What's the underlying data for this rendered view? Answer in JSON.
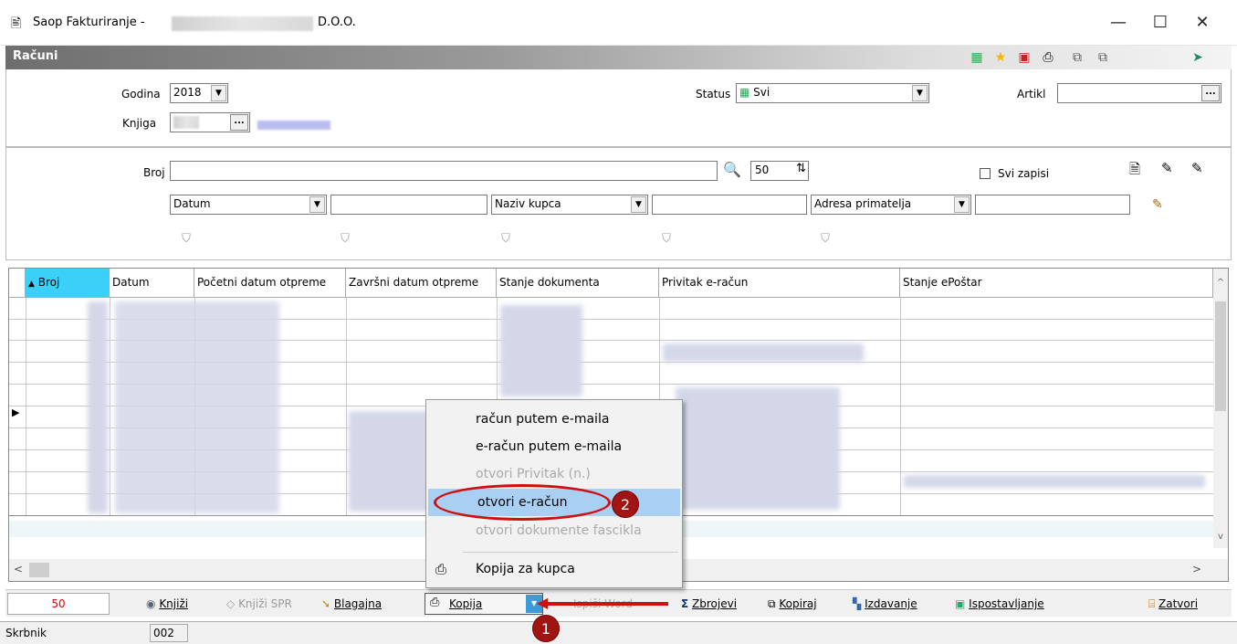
{
  "window": {
    "app_title_prefix": "Saop Fakturiranje -",
    "app_title_suffix": "D.O.O.",
    "minimize": "—",
    "maximize": "☐",
    "close": "✕"
  },
  "module": {
    "title": "Računi",
    "toolbar_icons": [
      "grid-icon",
      "star-icon",
      "pdf-icon",
      "print-icon",
      "copy-icon",
      "paste-icon",
      "export-icon"
    ]
  },
  "filters": {
    "godina_label": "Godina",
    "godina_value": "2018",
    "knjiga_label": "Knjiga",
    "status_label": "Status",
    "status_value": "Svi",
    "artikl_label": "Artikl",
    "broj_label": "Broj",
    "page_size": "50",
    "svi_zapisi_label": "Svi zapisi",
    "field1": "Datum",
    "field2": "Naziv kupca",
    "field3": "Adresa primatelja"
  },
  "grid": {
    "columns": [
      "Broj",
      "Datum",
      "Početni datum otpreme",
      "Završni datum otpreme",
      "Stanje dokumenta",
      "Privitak e-račun",
      "Stanje ePoštar"
    ],
    "sort_arrow": "▲"
  },
  "context_menu": {
    "items": [
      {
        "label": "račun putem e-maila",
        "enabled": true
      },
      {
        "label": "e-račun putem e-maila",
        "enabled": true
      },
      {
        "label": "otvori Privitak (n.)",
        "enabled": false
      },
      {
        "label": "otvori e-račun",
        "enabled": true,
        "highlighted": true
      },
      {
        "label": "otvori dokumente fascikla",
        "enabled": false
      },
      {
        "label": "Kopija za kupca",
        "enabled": true
      }
    ]
  },
  "bottom_bar": {
    "count": "50",
    "knjizi": "Knjiži",
    "knjizi_spr": "Knjiži SPR",
    "blagajna": "Blagajna",
    "kopija": "Kopija",
    "ispisi_word": "Ispiši Word",
    "zbrojevi": "Zbrojevi",
    "kopiraj": "Kopiraj",
    "izdavanje": "Izdavanje",
    "ispostavljanje": "Ispostavljanje",
    "zatvori": "Zatvori"
  },
  "status_bar": {
    "label": "Skrbnik",
    "value": "002"
  },
  "annotations": {
    "badge1": "1",
    "badge2": "2",
    "accent": "#a01414"
  }
}
